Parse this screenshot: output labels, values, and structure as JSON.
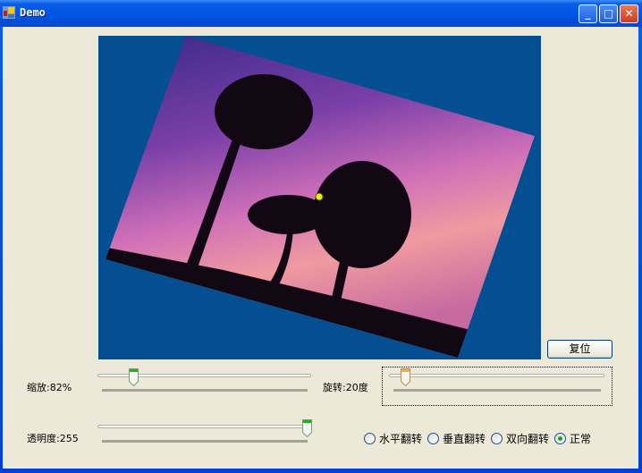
{
  "window": {
    "title": "Demo"
  },
  "buttons": {
    "reset": "复位"
  },
  "sliders": {
    "zoom": {
      "label": "缩放:82%",
      "value_percent": 82,
      "position_fraction": 0.16
    },
    "rotate": {
      "label": "旋转:20度",
      "value_degrees": 20,
      "position_fraction": 0.06
    },
    "opacity": {
      "label": "透明度:255",
      "value": 255,
      "position_fraction": 1.0
    }
  },
  "flip_options": [
    {
      "label": "水平翻转",
      "checked": false
    },
    {
      "label": "垂直翻转",
      "checked": false
    },
    {
      "label": "双向翻转",
      "checked": false
    },
    {
      "label": "正常",
      "checked": true
    }
  ],
  "colors": {
    "canvas_bg": "#034f91",
    "center_marker": "#e8f000"
  }
}
